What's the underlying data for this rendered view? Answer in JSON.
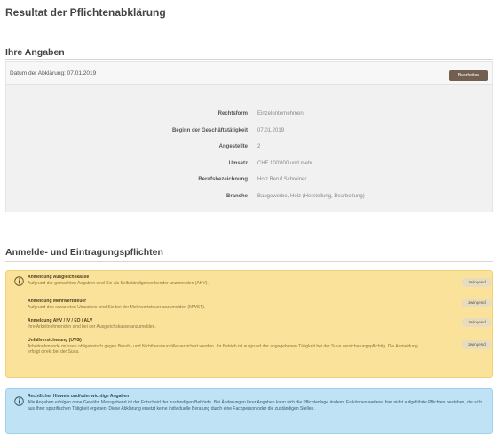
{
  "page_title": "Resultat der Pflichtenabklärung",
  "details": {
    "section_title": "Ihre Angaben",
    "date_label": "Datum der Abklärung: 07.01.2019",
    "edit_button": "Bearbeiten",
    "rows": [
      {
        "key": "Rechtsform",
        "value": "Einzelunternehmen"
      },
      {
        "key": "Beginn der Geschäftstätigkeit",
        "value": "07.01.2019"
      },
      {
        "key": "Angestellte",
        "value": "2"
      },
      {
        "key": "Umsatz",
        "value": "CHF 100'000 und mehr"
      },
      {
        "key": "Berufsbezeichnung",
        "value": "Holz Beruf Schreiner"
      },
      {
        "key": "Branche",
        "value": "Baugewerbe, Holz (Herstellung, Bearbeitung)"
      }
    ]
  },
  "duties": {
    "section_title": "Anmelde- und Eintragungspflichten",
    "items": [
      {
        "title": "Anmeldung Ausgleichskasse",
        "desc": "Aufgrund der gemachten Angaben sind Sie als Selbständigerwerbender anzumelden (AHV).",
        "badge": "Zwingend"
      },
      {
        "title": "Anmeldung Mehrwertsteuer",
        "desc": "Aufgrund des erwarteten Umsatzes sind Sie bei der Mehrwertsteuer anzumelden (MWST).",
        "badge": "Zwingend"
      },
      {
        "title": "Anmeldung AHV / IV / EO / ALV",
        "desc": "Ihre Arbeitnehmenden sind bei der Ausgleichskasse anzumelden.",
        "badge": "Zwingend"
      },
      {
        "title": "Unfallversicherung (UVG)",
        "desc": "Arbeitnehmende müssen obligatorisch gegen Berufs- und Nichtberufsunfälle versichert werden. Ihr Betrieb ist aufgrund der angegebenen Tätigkeit bei der Suva versicherungspflichtig. Die Anmeldung erfolgt direkt bei der Suva.",
        "badge": "Zwingend"
      }
    ]
  },
  "note": {
    "title": "Rechtlicher Hinweis und/oder wichtige Angaben",
    "text": "Alle Angaben erfolgen ohne Gewähr. Massgebend ist der Entscheid der zuständigen Behörde. Bei Änderungen Ihrer Angaben kann sich die Pflichtenlage ändern. Es können weitere, hier nicht aufgeführte Pflichten bestehen, die sich aus Ihrer spezifischen Tätigkeit ergeben. Diese Abklärung ersetzt keine individuelle Beratung durch eine Fachperson oder die zuständigen Stellen."
  },
  "colors": {
    "accent": "#735f52",
    "warning_bg": "#fbe29a",
    "info_bg": "#bfe3f5"
  }
}
